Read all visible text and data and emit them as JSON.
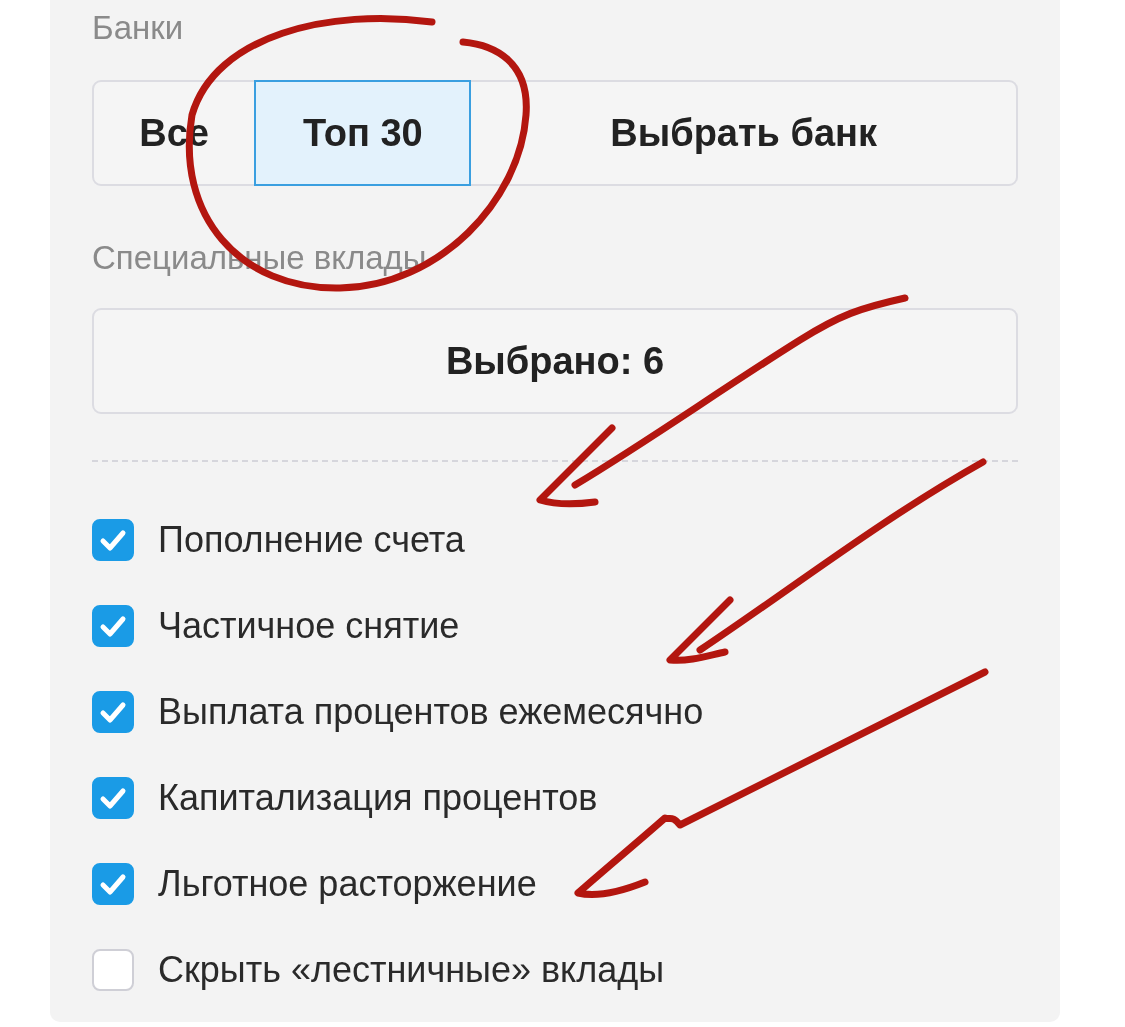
{
  "banks": {
    "label": "Банки",
    "options": [
      {
        "label": "Все",
        "selected": false
      },
      {
        "label": "Топ 30",
        "selected": true
      },
      {
        "label": "Выбрать банк",
        "selected": false
      }
    ]
  },
  "special_deposits": {
    "label": "Специальные вклады",
    "button": "Выбрано: 6"
  },
  "options": [
    {
      "label": "Пополнение счета",
      "checked": true
    },
    {
      "label": "Частичное снятие",
      "checked": true
    },
    {
      "label": "Выплата процентов ежемесячно",
      "checked": true
    },
    {
      "label": "Капитализация процентов",
      "checked": true
    },
    {
      "label": "Льготное расторжение",
      "checked": true
    },
    {
      "label": "Скрыть «лестничные» вклады",
      "checked": false
    }
  ]
}
